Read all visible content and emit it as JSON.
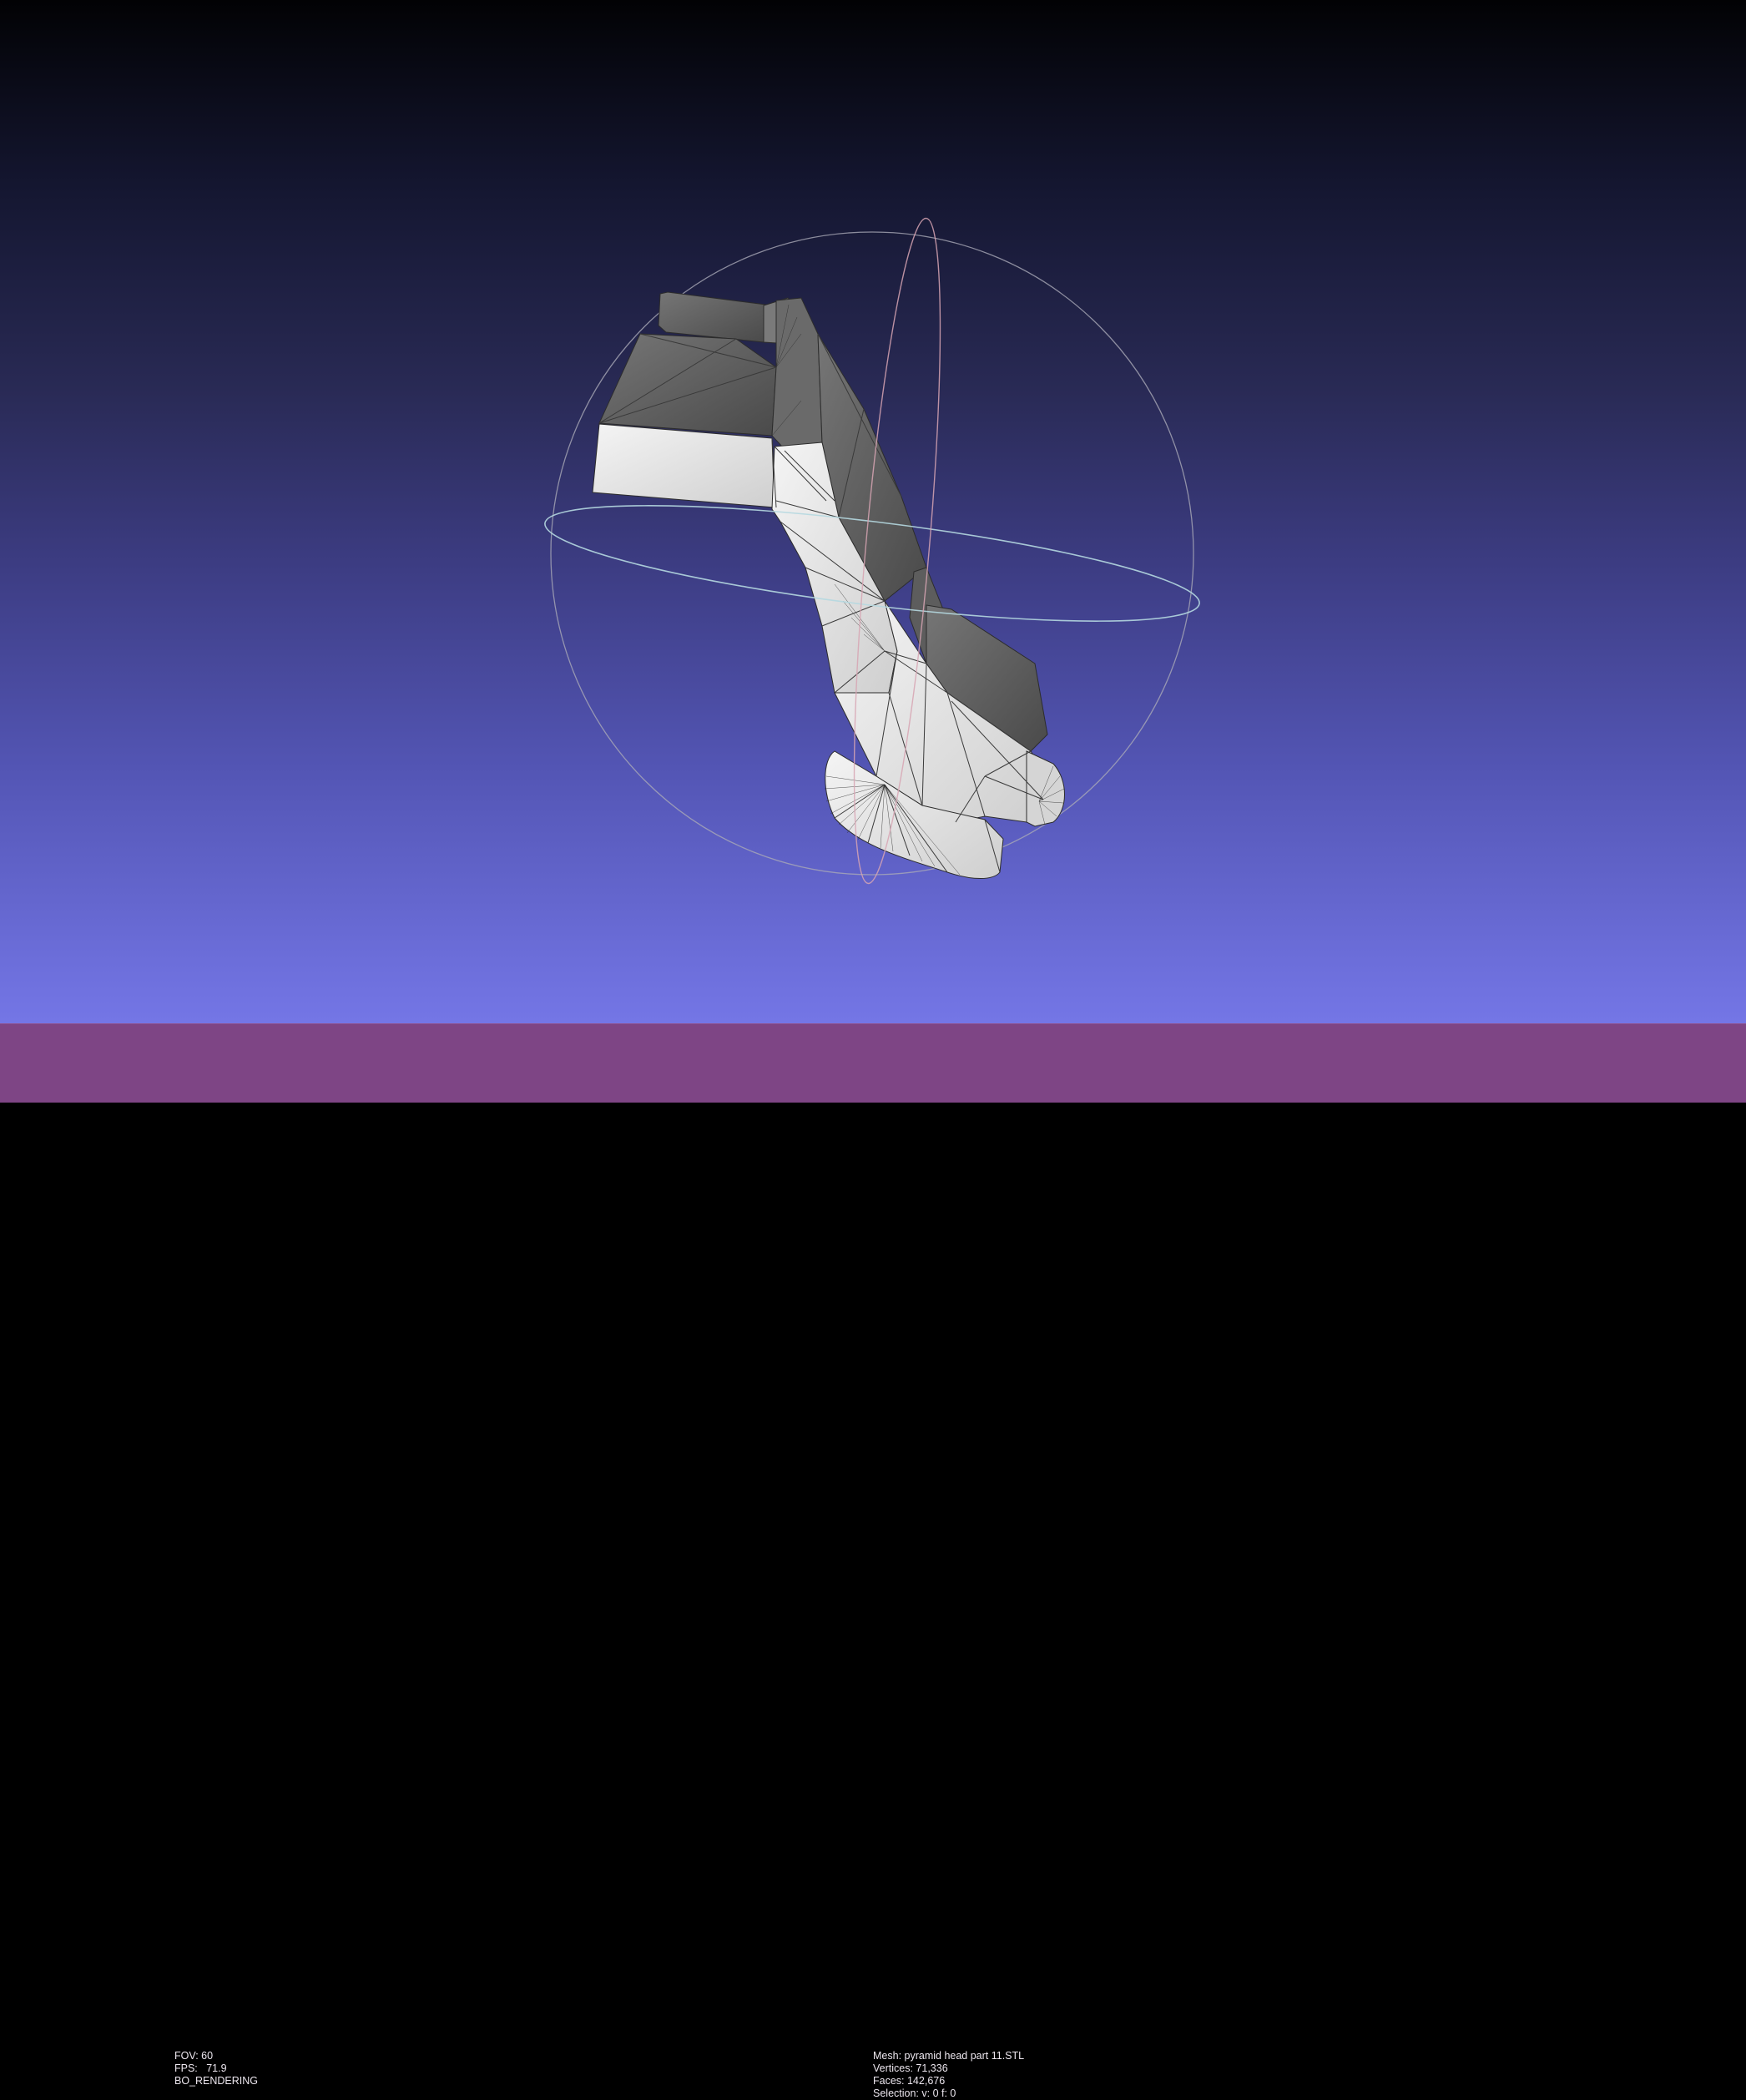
{
  "viewport": {
    "colors": {
      "background_top": "#020204",
      "background_bottom": "#7476e6",
      "statusbar": "#7e4585",
      "trackball_horizontal": "#b5d8e0",
      "trackball_vertical": "#d7a5b3",
      "trackball_sphere": "#a9a9b7",
      "mesh_light": "#e6e6e6",
      "mesh_dark": "#5a5a5a"
    }
  },
  "status": {
    "left": {
      "fov": "FOV: 60",
      "fps": "FPS:   71.9",
      "mode": "BO_RENDERING"
    },
    "right": {
      "mesh": "Mesh: pyramid head part 11.STL",
      "vertices": "Vertices: 71,336",
      "faces": "Faces: 142,676",
      "selection": "Selection: v: 0 f: 0"
    }
  }
}
